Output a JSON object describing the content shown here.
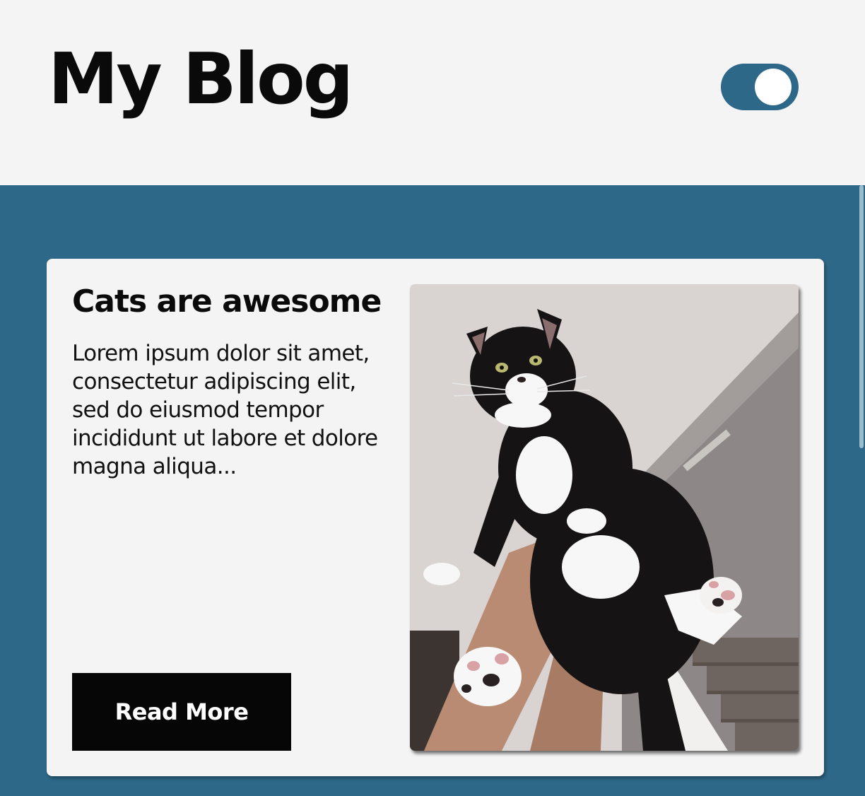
{
  "header": {
    "title": "My Blog",
    "theme_toggle": {
      "state": "on",
      "color": "#2e6888"
    }
  },
  "colors": {
    "page_background": "#f4f4f4",
    "main_background": "#2e6888",
    "card_background": "#f4f4f4",
    "button_background": "#060606"
  },
  "post": {
    "title": "Cats are awesome",
    "excerpt": "Lorem ipsum dolor sit amet, consectetur adipiscing elit, sed do eiusmod tempor incididunt ut labore et dolore magna aliqua...",
    "read_more_label": "Read More",
    "image": {
      "subject": "black-and-white tuxedo cat held up by a hand on a staircase"
    }
  }
}
